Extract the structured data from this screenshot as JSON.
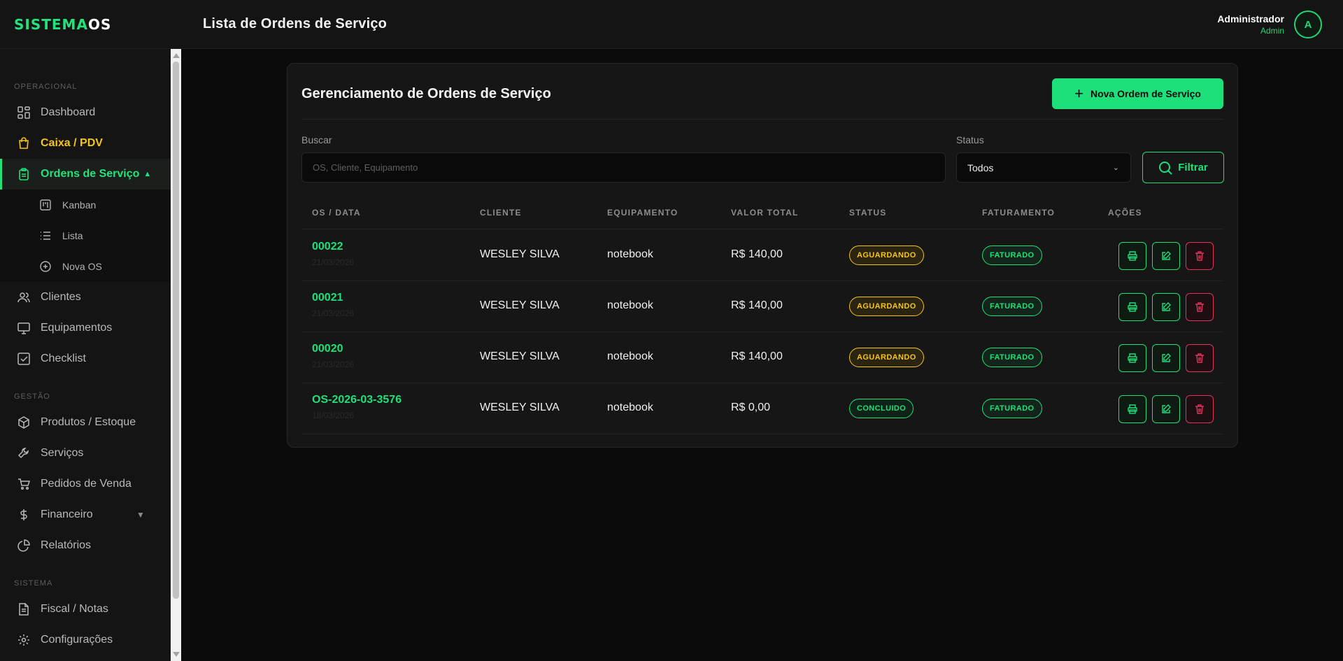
{
  "app": {
    "logo_part1": "SISTEMA",
    "logo_part2": "OS"
  },
  "header": {
    "title": "Lista de Ordens de Serviço"
  },
  "user": {
    "name": "Administrador",
    "role": "Admin",
    "initial": "A"
  },
  "sidebar": {
    "sections": {
      "operacional": "OPERACIONAL",
      "gestao": "GESTÃO",
      "sistema": "SISTEMA"
    },
    "items": {
      "dashboard": "Dashboard",
      "caixa": "Caixa / PDV",
      "ordens": "Ordens de Serviço",
      "kanban": "Kanban",
      "lista": "Lista",
      "nova_os": "Nova OS",
      "clientes": "Clientes",
      "equipamentos": "Equipamentos",
      "checklist": "Checklist",
      "produtos": "Produtos / Estoque",
      "servicos": "Serviços",
      "pedidos": "Pedidos de Venda",
      "financeiro": "Financeiro",
      "relatorios": "Relatórios",
      "fiscal": "Fiscal / Notas",
      "configuracoes": "Configurações"
    }
  },
  "card": {
    "title": "Gerenciamento de Ordens de Serviço",
    "new_button": "Nova Ordem de Serviço",
    "search_label": "Buscar",
    "search_placeholder": "OS, Cliente, Equipamento",
    "status_label": "Status",
    "status_value": "Todos",
    "filter_button": "Filtrar"
  },
  "table": {
    "headers": {
      "os": "OS / DATA",
      "cliente": "CLIENTE",
      "equipamento": "EQUIPAMENTO",
      "valor": "VALOR TOTAL",
      "status": "STATUS",
      "faturamento": "FATURAMENTO",
      "acoes": "AÇÕES"
    },
    "rows": [
      {
        "os": "00022",
        "date": "21/03/2026",
        "cliente": "WESLEY SILVA",
        "equipamento": "notebook",
        "valor": "R$ 140,00",
        "status": "AGUARDANDO",
        "faturamento": "FATURADO"
      },
      {
        "os": "00021",
        "date": "21/03/2026",
        "cliente": "WESLEY SILVA",
        "equipamento": "notebook",
        "valor": "R$ 140,00",
        "status": "AGUARDANDO",
        "faturamento": "FATURADO"
      },
      {
        "os": "00020",
        "date": "21/03/2026",
        "cliente": "WESLEY SILVA",
        "equipamento": "notebook",
        "valor": "R$ 140,00",
        "status": "AGUARDANDO",
        "faturamento": "FATURADO"
      },
      {
        "os": "OS-2026-03-3576",
        "date": "18/03/2026",
        "cliente": "WESLEY SILVA",
        "equipamento": "notebook",
        "valor": "R$ 0,00",
        "status": "CONCLUIDO",
        "faturamento": "FATURADO"
      }
    ]
  },
  "colors": {
    "accent": "#1de07a",
    "warning": "#f5c518",
    "danger": "#e0335a",
    "background": "#0b0b0b"
  }
}
